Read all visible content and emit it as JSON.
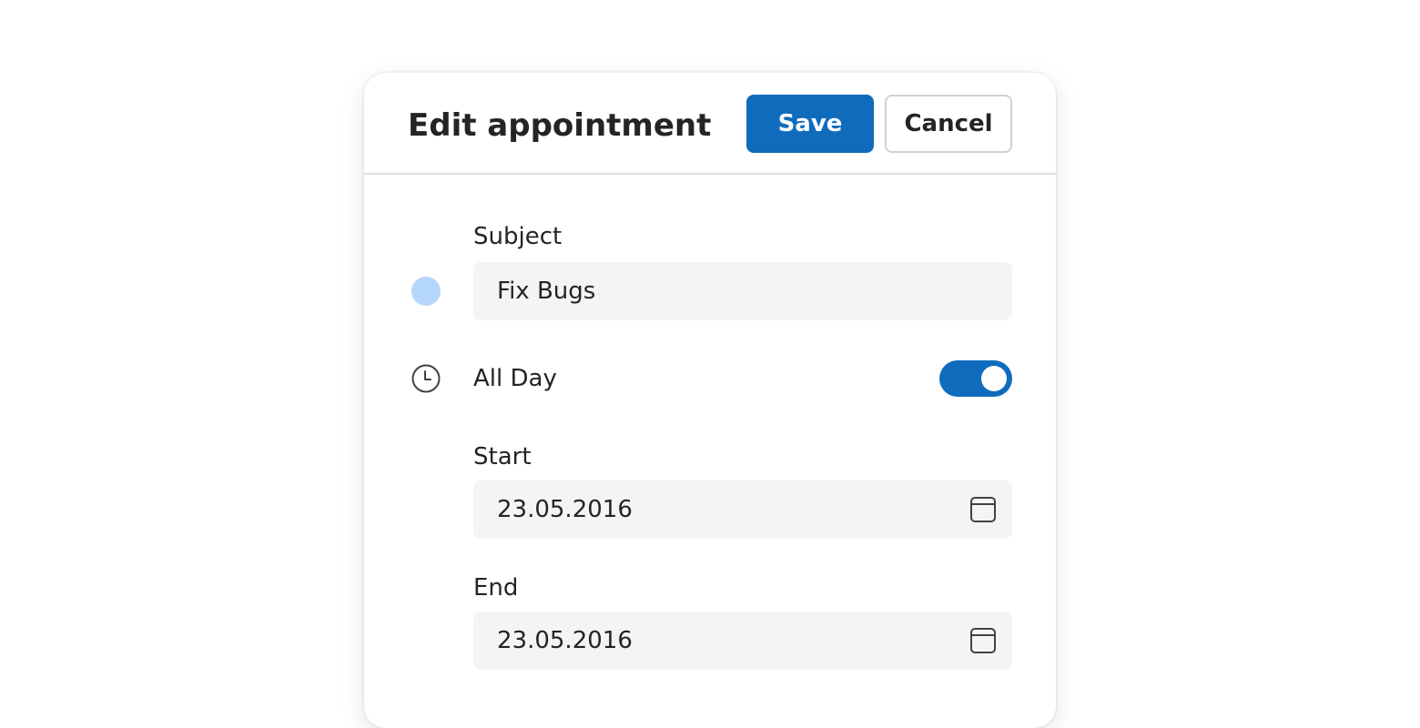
{
  "dialog": {
    "title": "Edit appointment",
    "save_label": "Save",
    "cancel_label": "Cancel"
  },
  "subject": {
    "label": "Subject",
    "value": "Fix Bugs",
    "color": "#b4d6fa"
  },
  "all_day": {
    "label": "All Day",
    "checked": true,
    "icon": "clock-icon"
  },
  "start": {
    "label": "Start",
    "value": "23.05.2016",
    "icon": "calendar-icon"
  },
  "end": {
    "label": "End",
    "value": "23.05.2016",
    "icon": "calendar-icon"
  },
  "colors": {
    "accent": "#0f6cbd",
    "field_background": "#f4f4f4"
  }
}
